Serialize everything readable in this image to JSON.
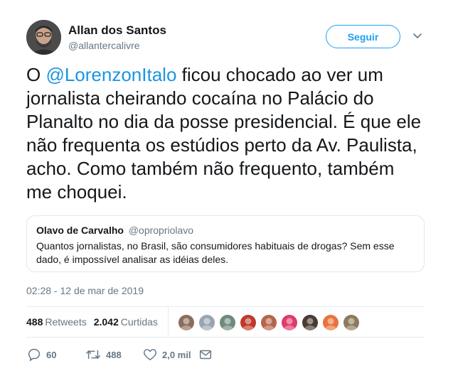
{
  "author": {
    "name": "Allan dos Santos",
    "handle": "@allantercalivre"
  },
  "follow_button": {
    "label": "Seguir"
  },
  "tweet": {
    "text_before": "O ",
    "mention": "@LorenzonItalo",
    "text_after": " ficou chocado ao ver um jornalista cheirando cocaína no Palácio do Planalto no dia da posse presidencial. É que ele não frequenta os estúdios perto da Av. Paulista, acho. Como também não frequento, também me choquei."
  },
  "quoted_tweet": {
    "name": "Olavo de Carvalho",
    "handle": "@opropriolavo",
    "text": "Quantos jornalistas, no Brasil, são consumidores habituais de drogas? Sem esse dado, é impossível analisar as idéias deles."
  },
  "timestamp": "02:28 - 12 de mar de 2019",
  "stats": {
    "retweets_count": "488",
    "retweets_label": "Retweets",
    "likes_count": "2.042",
    "likes_label": "Curtidas"
  },
  "liker_avatars": [
    {
      "icon": "liker-avatar-1",
      "color": "#8a6d5a"
    },
    {
      "icon": "liker-avatar-2",
      "color": "#9aa5b1"
    },
    {
      "icon": "liker-avatar-3",
      "color": "#6f8a7c"
    },
    {
      "icon": "liker-avatar-4",
      "color": "#c0392b"
    },
    {
      "icon": "liker-avatar-5",
      "color": "#b5654a"
    },
    {
      "icon": "liker-avatar-6",
      "color": "#e03a6a"
    },
    {
      "icon": "liker-avatar-7",
      "color": "#4a3b32"
    },
    {
      "icon": "liker-avatar-8",
      "color": "#e8743b"
    },
    {
      "icon": "liker-avatar-9",
      "color": "#8c7a5b"
    }
  ],
  "actions": {
    "reply_count": "60",
    "retweet_count": "488",
    "like_count": "2,0 mil"
  },
  "colors": {
    "accent": "#1da1f2",
    "mention": "#1b95e0",
    "secondary_text": "#657786",
    "border": "#e1e8ed"
  }
}
